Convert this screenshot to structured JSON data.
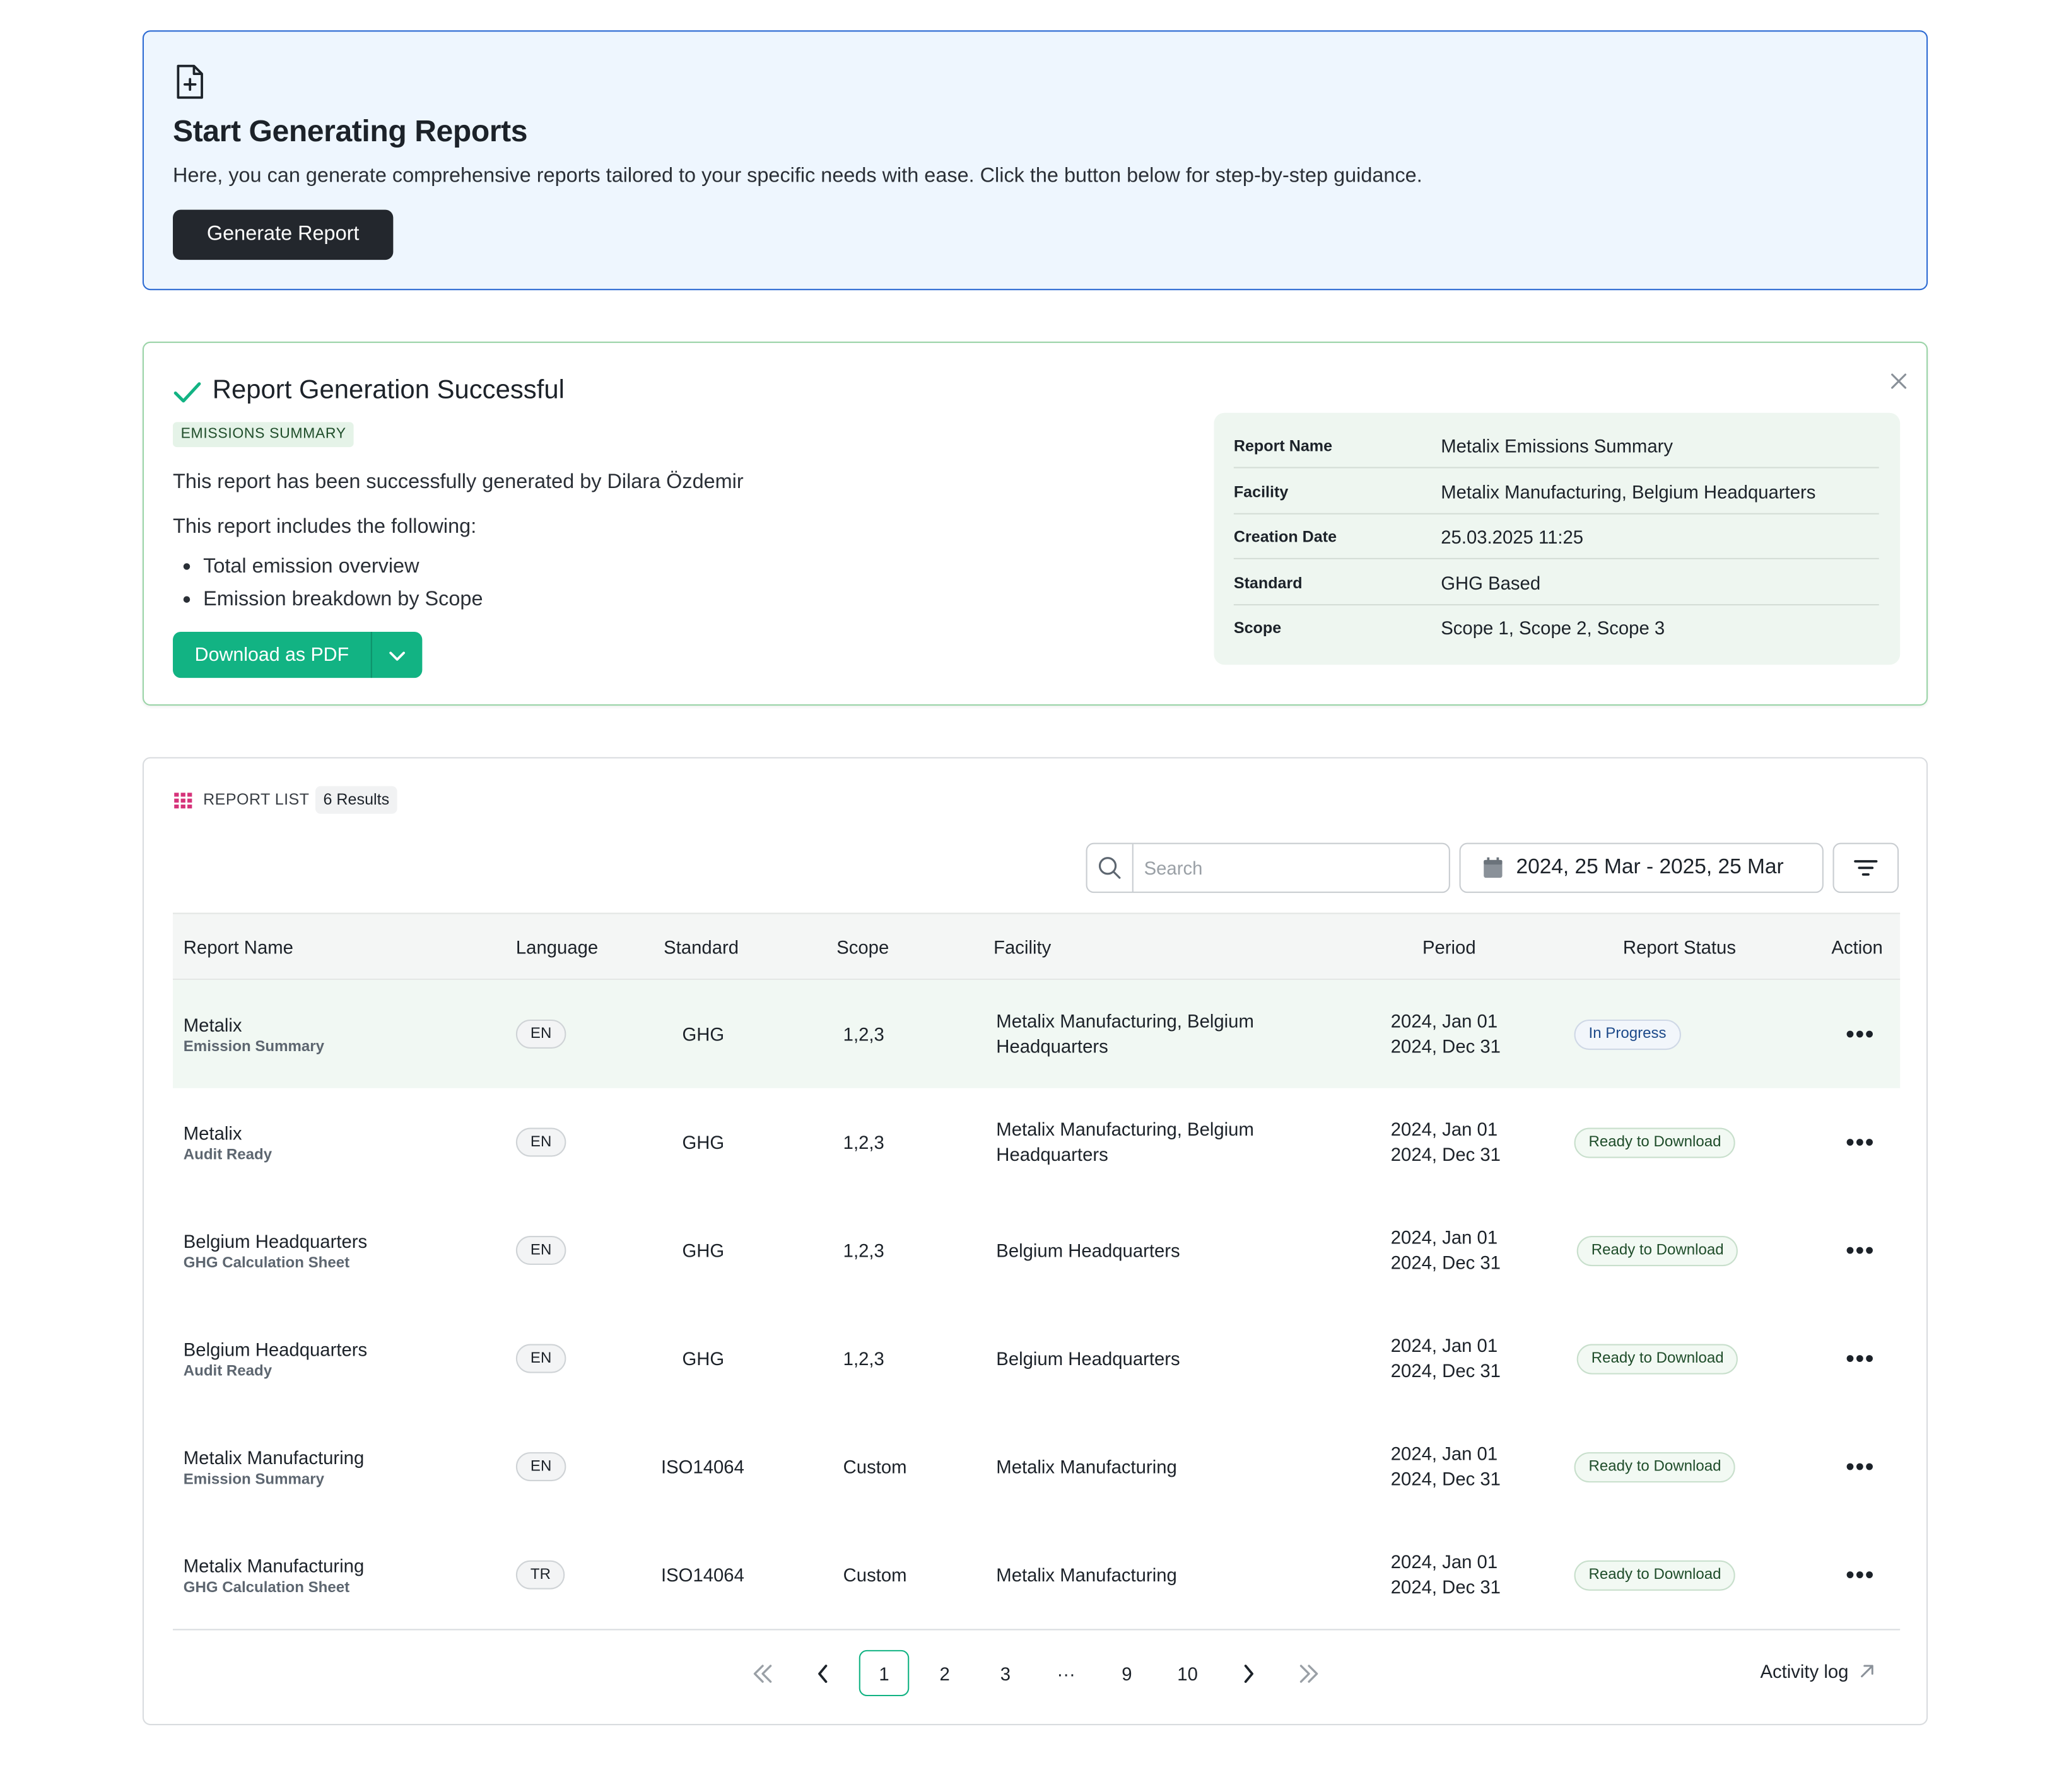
{
  "start": {
    "title": "Start Generating Reports",
    "description": "Here, you can generate comprehensive reports tailored to your specific needs with ease. Click the button below for step-by-step guidance.",
    "button_label": "Generate Report"
  },
  "success": {
    "title": "Report Generation Successful",
    "tag": "EMISSIONS SUMMARY",
    "description": "This report has been successfully generated by Dilara Özdemir",
    "includes_label": "This report includes the following:",
    "bullets": [
      "Total emission overview",
      "Emission breakdown by Scope"
    ],
    "download_label": "Download as PDF",
    "info": [
      {
        "key": "Report Name",
        "value": "Metalix Emissions Summary"
      },
      {
        "key": "Facility",
        "value": "Metalix Manufacturing, Belgium Headquarters"
      },
      {
        "key": "Creation Date",
        "value": "25.03.2025 11:25"
      },
      {
        "key": "Standard",
        "value": "GHG Based"
      },
      {
        "key": "Scope",
        "value": "Scope 1, Scope 2, Scope 3"
      }
    ]
  },
  "report_list": {
    "label": "REPORT LIST",
    "results": "6 Results",
    "search_placeholder": "Search",
    "date_range": "2024, 25 Mar - 2025, 25 Mar",
    "columns": [
      "Report Name",
      "Language",
      "Standard",
      "Scope",
      "Facility",
      "Period",
      "Report Status",
      "Action"
    ],
    "rows": [
      {
        "name": "Metalix",
        "sub": "Emission Summary",
        "lang": "EN",
        "standard": "GHG",
        "scope": "1,2,3",
        "facility": "Metalix Manufacturing, Belgium Headquarters",
        "period_start": "2024, Jan 01",
        "period_end": "2024, Dec 31",
        "status": "In Progress"
      },
      {
        "name": "Metalix",
        "sub": "Audit Ready",
        "lang": "EN",
        "standard": "GHG",
        "scope": "1,2,3",
        "facility": "Metalix Manufacturing, Belgium Headquarters",
        "period_start": "2024, Jan 01",
        "period_end": "2024, Dec 31",
        "status": "Ready to Download"
      },
      {
        "name": "Belgium Headquarters",
        "sub": "GHG Calculation Sheet",
        "lang": "EN",
        "standard": "GHG",
        "scope": "1,2,3",
        "facility": "Belgium Headquarters",
        "period_start": "2024, Jan 01",
        "period_end": "2024, Dec 31",
        "status": "Ready to Download"
      },
      {
        "name": "Belgium Headquarters",
        "sub": "Audit Ready",
        "lang": "EN",
        "standard": "GHG",
        "scope": "1,2,3",
        "facility": "Belgium Headquarters",
        "period_start": "2024, Jan 01",
        "period_end": "2024, Dec 31",
        "status": "Ready to Download"
      },
      {
        "name": "Metalix Manufacturing",
        "sub": "Emission Summary",
        "lang": "EN",
        "standard": "ISO14064",
        "scope": "Custom",
        "facility": "Metalix Manufacturing",
        "period_start": "2024, Jan 01",
        "period_end": "2024, Dec 31",
        "status": "Ready to Download"
      },
      {
        "name": "Metalix Manufacturing",
        "sub": "GHG Calculation Sheet",
        "lang": "TR",
        "standard": "ISO14064",
        "scope": "Custom",
        "facility": "Metalix Manufacturing",
        "period_start": "2024, Jan 01",
        "period_end": "2024, Dec 31",
        "status": "Ready to Download"
      }
    ],
    "action_label": "•••",
    "pagination": {
      "pages": [
        "1",
        "2",
        "3",
        "···",
        "9",
        "10"
      ],
      "current": "1"
    },
    "activity_log": "Activity log"
  },
  "colors": {
    "accent_green": "#12b383",
    "start_border": "#2d6bd3",
    "start_bg": "#eef6fe",
    "success_border": "#9bd4a8",
    "grid_icon": "#d6337a"
  },
  "icons": [
    "document-plus-icon",
    "check-icon",
    "close-icon",
    "grid-icon",
    "search-icon",
    "calendar-icon",
    "filter-icon",
    "chevron-down-icon",
    "double-chevron-left-icon",
    "chevron-left-icon",
    "chevron-right-icon",
    "double-chevron-right-icon",
    "arrow-up-right-icon"
  ]
}
